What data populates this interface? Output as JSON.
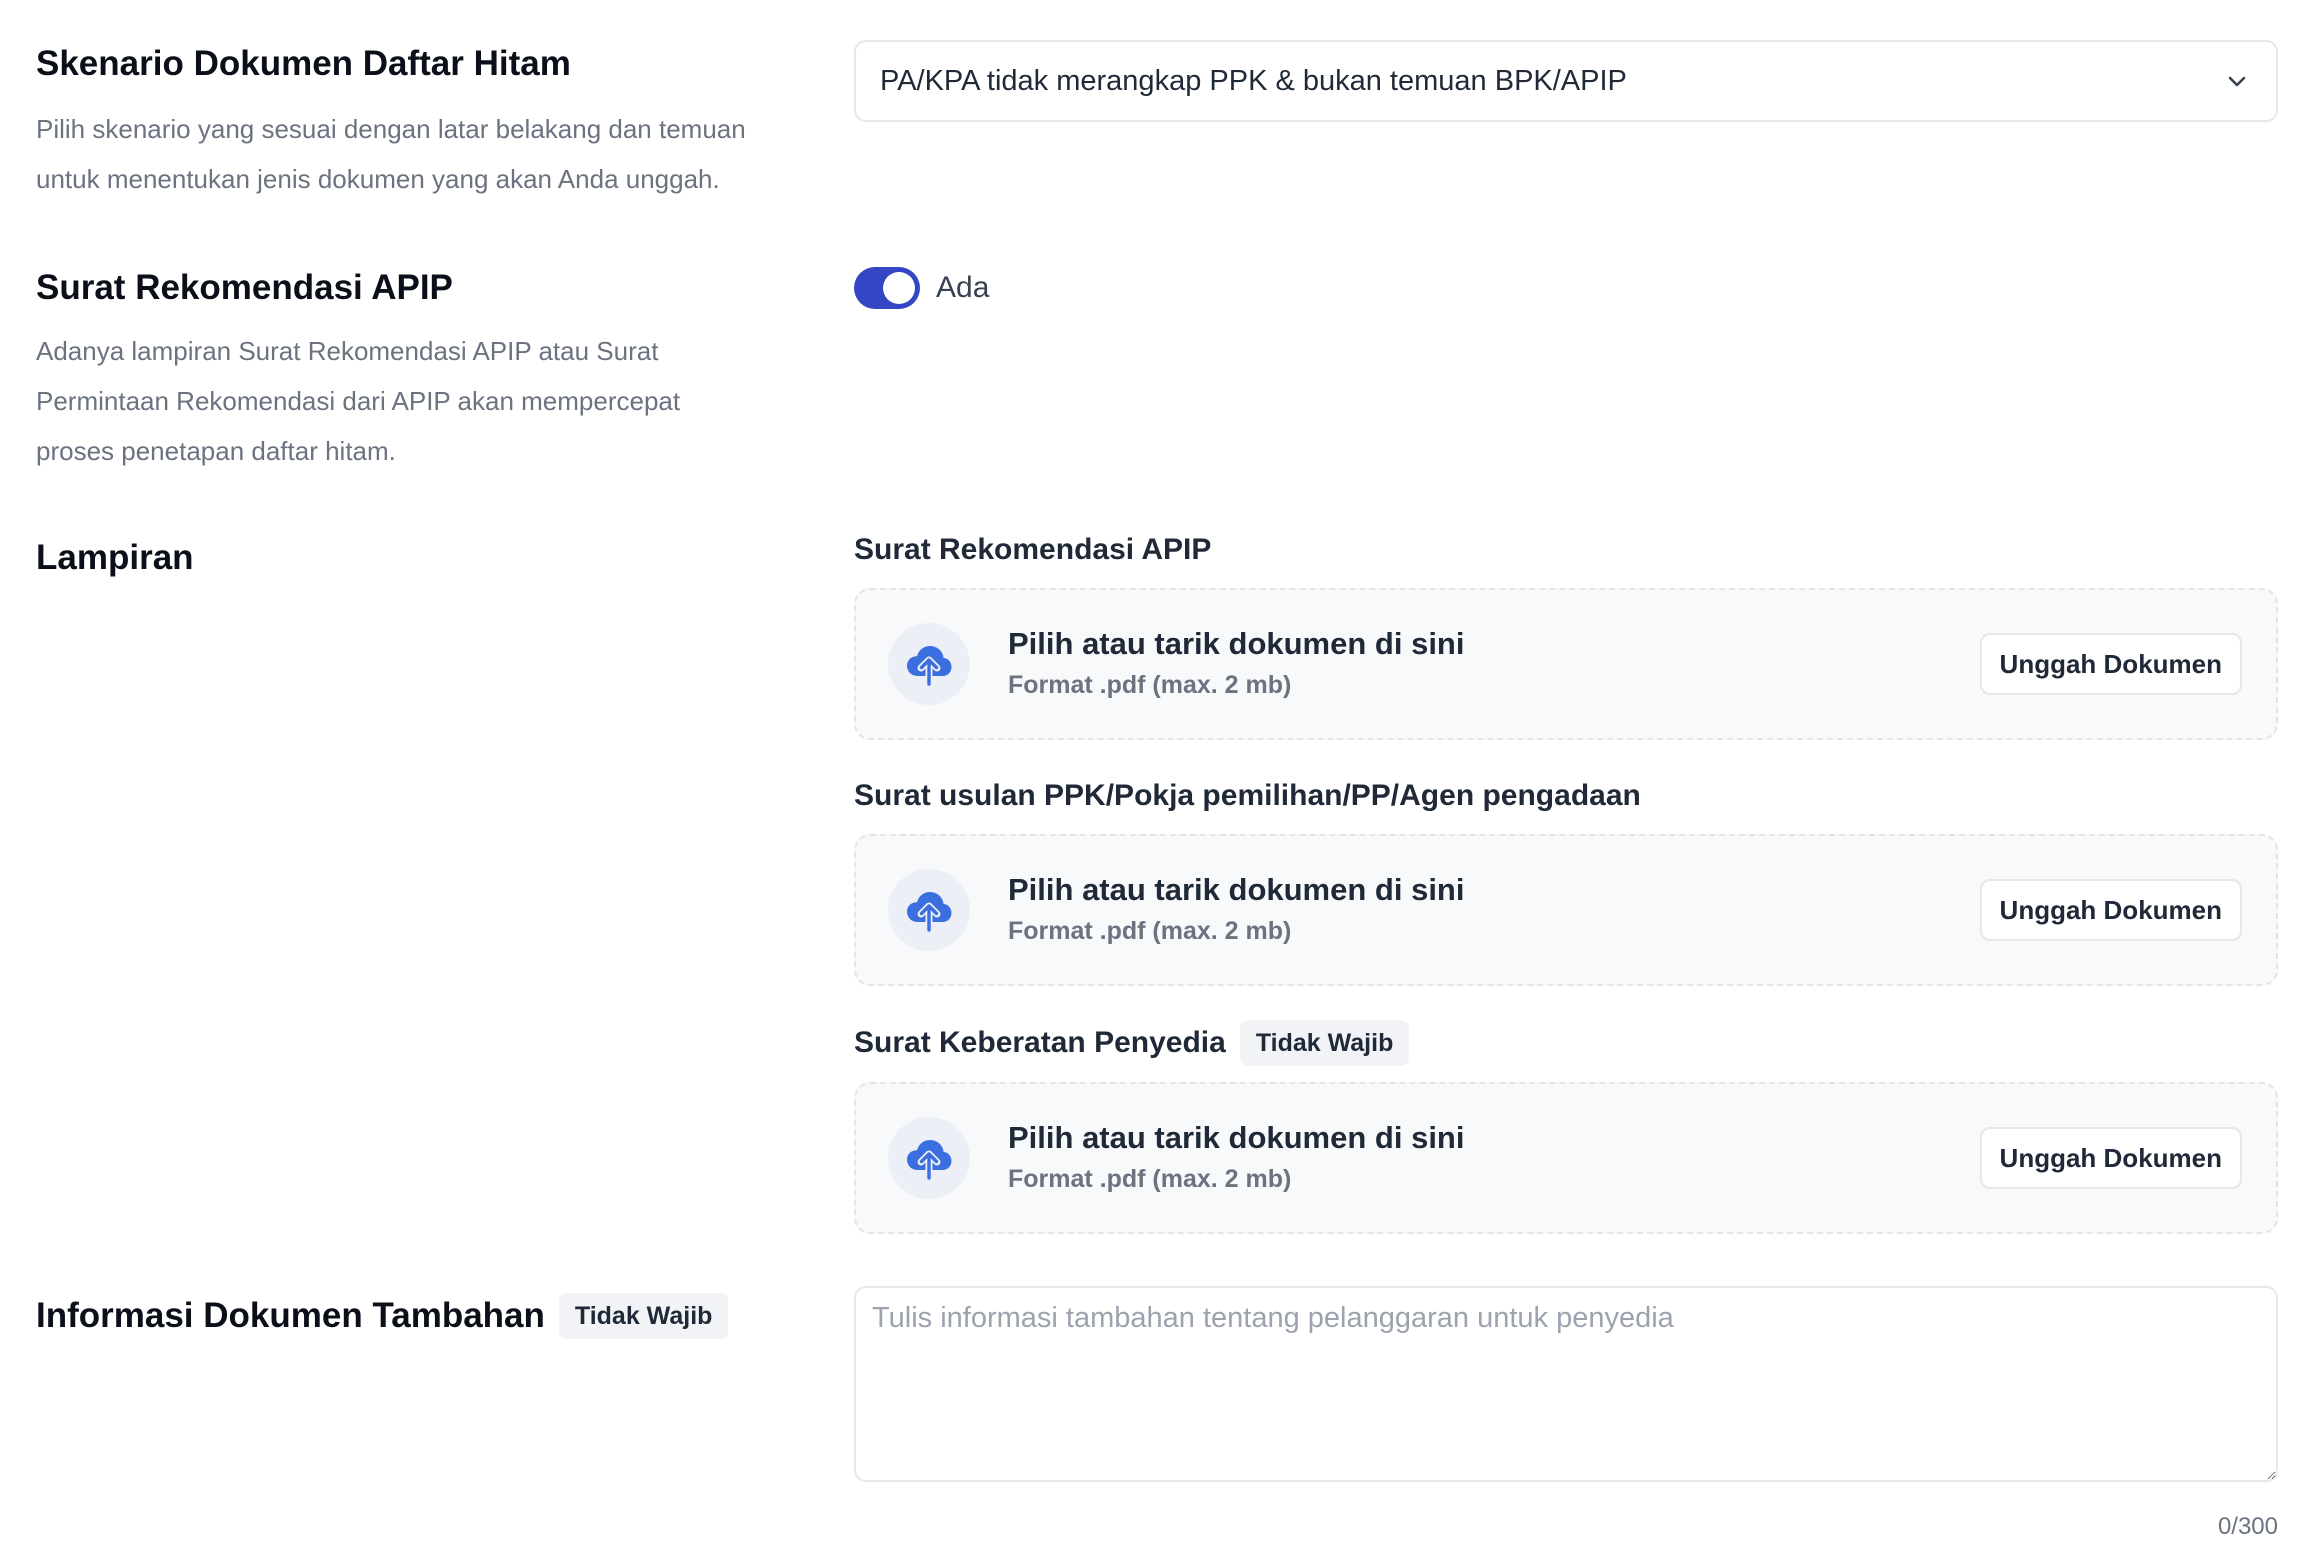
{
  "scenario": {
    "title": "Skenario Dokumen Daftar Hitam",
    "description": "Pilih skenario yang sesuai dengan latar belakang dan temuan untuk menentukan jenis dokumen yang akan Anda unggah.",
    "selected_value": "PA/KPA tidak merangkap PPK & bukan temuan BPK/APIP"
  },
  "recommendation": {
    "title": "Surat Rekomendasi APIP",
    "description": "Adanya lampiran Surat Rekomendasi APIP atau Surat Permintaan Rekomendasi dari APIP akan mempercepat proses penetapan daftar hitam.",
    "toggle_on": true,
    "toggle_label": "Ada"
  },
  "attachments": {
    "title": "Lampiran",
    "items": [
      {
        "label": "Surat Rekomendasi APIP",
        "badge": "",
        "upload_title": "Pilih atau tarik dokumen di sini",
        "upload_format": "Format .pdf (max. 2 mb)",
        "button_label": "Unggah Dokumen"
      },
      {
        "label": "Surat usulan PPK/Pokja pemilihan/PP/Agen pengadaan",
        "badge": "",
        "upload_title": "Pilih atau tarik dokumen di sini",
        "upload_format": "Format .pdf (max. 2 mb)",
        "button_label": "Unggah Dokumen"
      },
      {
        "label": "Surat Keberatan Penyedia",
        "badge": "Tidak Wajib",
        "upload_title": "Pilih atau tarik dokumen di sini",
        "upload_format": "Format .pdf (max. 2 mb)",
        "button_label": "Unggah Dokumen"
      }
    ]
  },
  "additional_info": {
    "title": "Informasi Dokumen Tambahan",
    "badge": "Tidak Wajib",
    "placeholder": "Tulis informasi tambahan tentang pelanggaran untuk penyedia",
    "value": "",
    "counter": "0/300"
  },
  "colors": {
    "accent": "#3346c3",
    "upload_icon": "#3b6fe0"
  }
}
